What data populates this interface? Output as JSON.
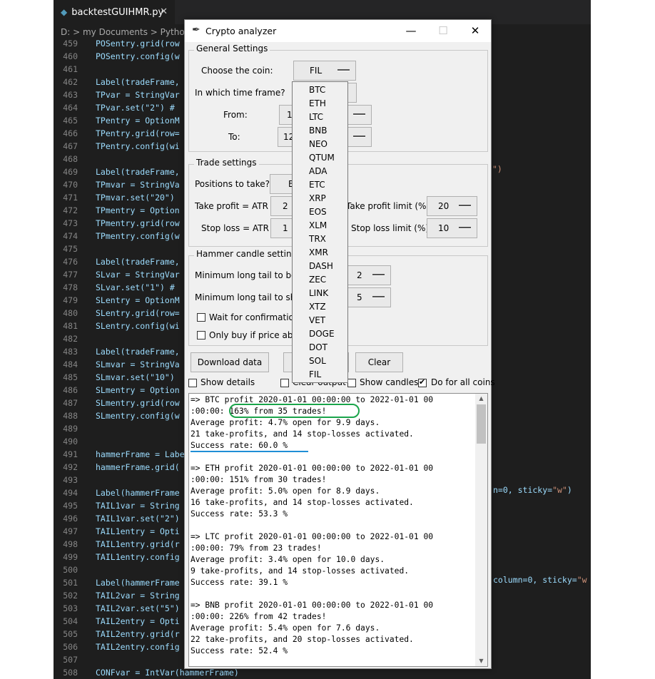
{
  "editor": {
    "tab_label": "backtestGUIHMR.py",
    "tab_close": "✕",
    "tab_icon": "python-file-icon",
    "breadcrumb": "D: > my Documents > Python",
    "lines": [
      {
        "n": "459",
        "t": "POSentry.grid(row"
      },
      {
        "n": "460",
        "t": "POSentry.config(w"
      },
      {
        "n": "461",
        "t": ""
      },
      {
        "n": "462",
        "t": "Label(tradeFrame,"
      },
      {
        "n": "463",
        "t": "TPvar = StringVar"
      },
      {
        "n": "464",
        "t": "TPvar.set(\"2\") #"
      },
      {
        "n": "465",
        "t": "TPentry = OptionM"
      },
      {
        "n": "466",
        "t": "TPentry.grid(row="
      },
      {
        "n": "467",
        "t": "TPentry.config(wi"
      },
      {
        "n": "468",
        "t": ""
      },
      {
        "n": "469",
        "t": "Label(tradeFrame,"
      },
      {
        "n": "470",
        "t": "TPmvar = StringVa"
      },
      {
        "n": "471",
        "t": "TPmvar.set(\"20\")"
      },
      {
        "n": "472",
        "t": "TPmentry = Option"
      },
      {
        "n": "473",
        "t": "TPmentry.grid(row"
      },
      {
        "n": "474",
        "t": "TPmentry.config(w"
      },
      {
        "n": "475",
        "t": ""
      },
      {
        "n": "476",
        "t": "Label(tradeFrame,"
      },
      {
        "n": "477",
        "t": "SLvar = StringVar"
      },
      {
        "n": "478",
        "t": "SLvar.set(\"1\") #"
      },
      {
        "n": "479",
        "t": "SLentry = OptionM"
      },
      {
        "n": "480",
        "t": "SLentry.grid(row="
      },
      {
        "n": "481",
        "t": "SLentry.config(wi"
      },
      {
        "n": "482",
        "t": ""
      },
      {
        "n": "483",
        "t": "Label(tradeFrame,"
      },
      {
        "n": "484",
        "t": "SLmvar = StringVa"
      },
      {
        "n": "485",
        "t": "SLmvar.set(\"10\")"
      },
      {
        "n": "486",
        "t": "SLmentry = Option"
      },
      {
        "n": "487",
        "t": "SLmentry.grid(row"
      },
      {
        "n": "488",
        "t": "SLmentry.config(w"
      },
      {
        "n": "489",
        "t": ""
      },
      {
        "n": "490",
        "t": ""
      },
      {
        "n": "491",
        "t": "hammerFrame = Labe"
      },
      {
        "n": "492",
        "t": "hammerFrame.grid("
      },
      {
        "n": "493",
        "t": ""
      },
      {
        "n": "494",
        "t": "Label(hammerFrame"
      },
      {
        "n": "495",
        "t": "TAIL1var = String"
      },
      {
        "n": "496",
        "t": "TAIL1var.set(\"2\")"
      },
      {
        "n": "497",
        "t": "TAIL1entry = Opti"
      },
      {
        "n": "498",
        "t": "TAIL1entry.grid(r"
      },
      {
        "n": "499",
        "t": "TAIL1entry.config"
      },
      {
        "n": "500",
        "t": ""
      },
      {
        "n": "501",
        "t": "Label(hammerFrame"
      },
      {
        "n": "502",
        "t": "TAIL2var = String"
      },
      {
        "n": "503",
        "t": "TAIL2var.set(\"5\")"
      },
      {
        "n": "504",
        "t": "TAIL2entry = Opti"
      },
      {
        "n": "505",
        "t": "TAIL2entry.grid(r"
      },
      {
        "n": "506",
        "t": "TAIL2entry.config"
      },
      {
        "n": "507",
        "t": ""
      },
      {
        "n": "508",
        "t": "CONFvar = IntVar(hammerFrame)"
      }
    ],
    "right_fragments": {
      "r469": "\")",
      "r494a": "n=0, sticky=",
      "r494b": "\"w\"",
      "r494c": ")",
      "r501a": "column=0, sticky=",
      "r501b": "\"w"
    }
  },
  "window": {
    "title": "Crypto analyzer",
    "app_icon": "feather-icon",
    "minimize": "—",
    "maximize": "☐",
    "close": "✕",
    "general": {
      "title": "General Settings",
      "coin_label": "Choose the coin:",
      "coin_value": "FIL",
      "timeframe_label": "In which time frame?",
      "from_label": "From:",
      "from_value": "1",
      "to_label": "To:",
      "to_value": "12"
    },
    "trade": {
      "title": "Trade settings",
      "positions_label": "Positions to take?",
      "positions_value": "B",
      "tp_label": "Take profit = ATR *",
      "tp_value": "2",
      "tp_limit_label": "Take profit limit (%):",
      "tp_limit_value": "20",
      "sl_label": "Stop loss = ATR *",
      "sl_value": "1",
      "sl_limit_label": "Stop loss limit (%):",
      "sl_limit_value": "10"
    },
    "hammer": {
      "title": "Hammer candle settings",
      "tail_body_label": "Minimum long tail to bod",
      "tail_body_value": "2",
      "tail_short_label": "Minimum long tail to sho",
      "tail_short_value": "5",
      "wait_label": "Wait for confirmation",
      "only_buy_label": "Only buy if price abov"
    },
    "buttons": {
      "download": "Download data",
      "clear": "Clear"
    },
    "checks": {
      "show_details": "Show details",
      "clear_output": "Clear output",
      "show_candles": "Show candles",
      "all_coins": "Do for all coins",
      "all_coins_checked": true
    },
    "output_lines": [
      "=> BTC profit 2020-01-01 00:00:00 to 2022-01-01 00",
      ":00:00: 163% from 35 trades!",
      "Average profit: 4.7% open for 9.9 days.",
      "21 take-profits, and 14 stop-losses activated.",
      "Success rate: 60.0 %",
      "",
      "=> ETH profit 2020-01-01 00:00:00 to 2022-01-01 00",
      ":00:00: 151% from 30 trades!",
      "Average profit: 5.0% open for 8.9 days.",
      "16 take-profits, and 14 stop-losses activated.",
      "Success rate: 53.3 %",
      "",
      "=> LTC profit 2020-01-01 00:00:00 to 2022-01-01 00",
      ":00:00: 79% from 23 trades!",
      "Average profit: 3.4% open for 10.0 days.",
      "9 take-profits, and 14 stop-losses activated.",
      "Success rate: 39.1 %",
      "",
      "=> BNB profit 2020-01-01 00:00:00 to 2022-01-01 00",
      ":00:00: 226% from 42 trades!",
      "Average profit: 5.4% open for 7.6 days.",
      "22 take-profits, and 20 stop-losses activated.",
      "Success rate: 52.4 %"
    ],
    "scroll_up": "▲",
    "scroll_down": "▼"
  },
  "coin_menu": [
    "BTC",
    "ETH",
    "LTC",
    "BNB",
    "NEO",
    "QTUM",
    "ADA",
    "ETC",
    "XRP",
    "EOS",
    "XLM",
    "TRX",
    "XMR",
    "DASH",
    "ZEC",
    "LINK",
    "XTZ",
    "VET",
    "DOGE",
    "DOT",
    "SOL",
    "FIL"
  ],
  "colors": {
    "highlight_green": "#1aa44a",
    "highlight_blue": "#1f8fd6",
    "editor_bg": "#1e1e1e"
  }
}
